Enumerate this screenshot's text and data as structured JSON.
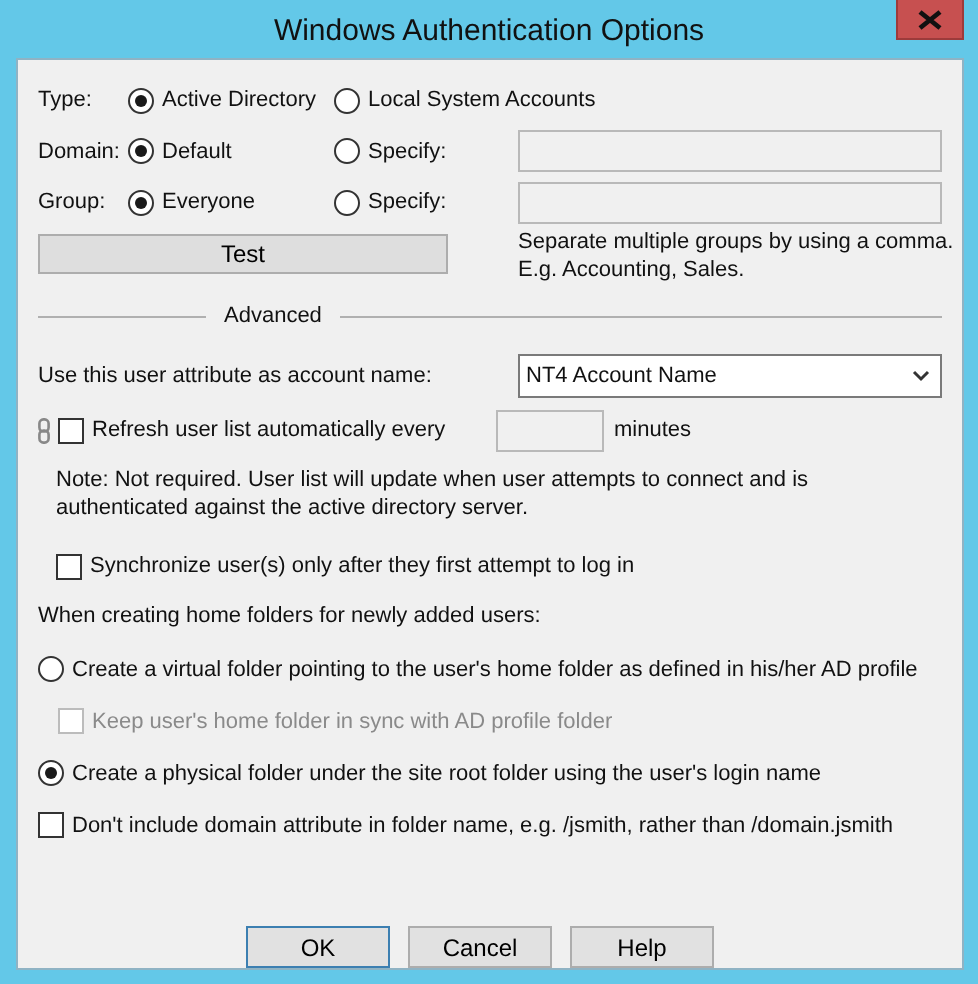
{
  "window": {
    "title": "Windows Authentication Options"
  },
  "type_row": {
    "label": "Type:",
    "options": [
      {
        "label": "Active Directory",
        "selected": true
      },
      {
        "label": "Local System Accounts",
        "selected": false
      }
    ]
  },
  "domain_row": {
    "label": "Domain:",
    "options": [
      {
        "label": "Default",
        "selected": true
      },
      {
        "label": "Specify:",
        "selected": false
      }
    ]
  },
  "group_row": {
    "label": "Group:",
    "options": [
      {
        "label": "Everyone",
        "selected": true
      },
      {
        "label": "Specify:",
        "selected": false
      }
    ],
    "hint": "Separate multiple groups by using a comma.\nE.g. Accounting, Sales."
  },
  "test_button": "Test",
  "section": "Advanced",
  "account_name": {
    "label": "Use this user attribute as account name:",
    "value": "NT4 Account Name"
  },
  "refresh": {
    "label": "Refresh user list automatically every",
    "checked": false,
    "unit": "minutes",
    "note": "Note: Not required. User list will update when user attempts to connect and is authenticated against the active directory server."
  },
  "sync": {
    "label": "Synchronize user(s) only after they first attempt to log in",
    "checked": false
  },
  "home_folders": {
    "label": "When creating home folders for newly added users:",
    "options": [
      {
        "kind": "radio",
        "label": "Create a virtual folder pointing to the user's home folder as defined in his/her AD profile",
        "selected": false,
        "disabled": false,
        "children": [
          {
            "kind": "checkbox",
            "label": "Keep user's home folder in sync with AD profile folder",
            "checked": false,
            "disabled": true
          }
        ]
      },
      {
        "kind": "radio",
        "label": "Create a physical folder under the site root folder using the user's login name",
        "selected": true,
        "disabled": false
      },
      {
        "kind": "checkbox",
        "label": "Don't include domain attribute in folder name, e.g. /jsmith, rather than /domain.jsmith",
        "checked": false,
        "disabled": false
      }
    ]
  },
  "buttons": [
    {
      "label": "OK",
      "default": true
    },
    {
      "label": "Cancel",
      "default": false
    },
    {
      "label": "Help",
      "default": false
    }
  ]
}
